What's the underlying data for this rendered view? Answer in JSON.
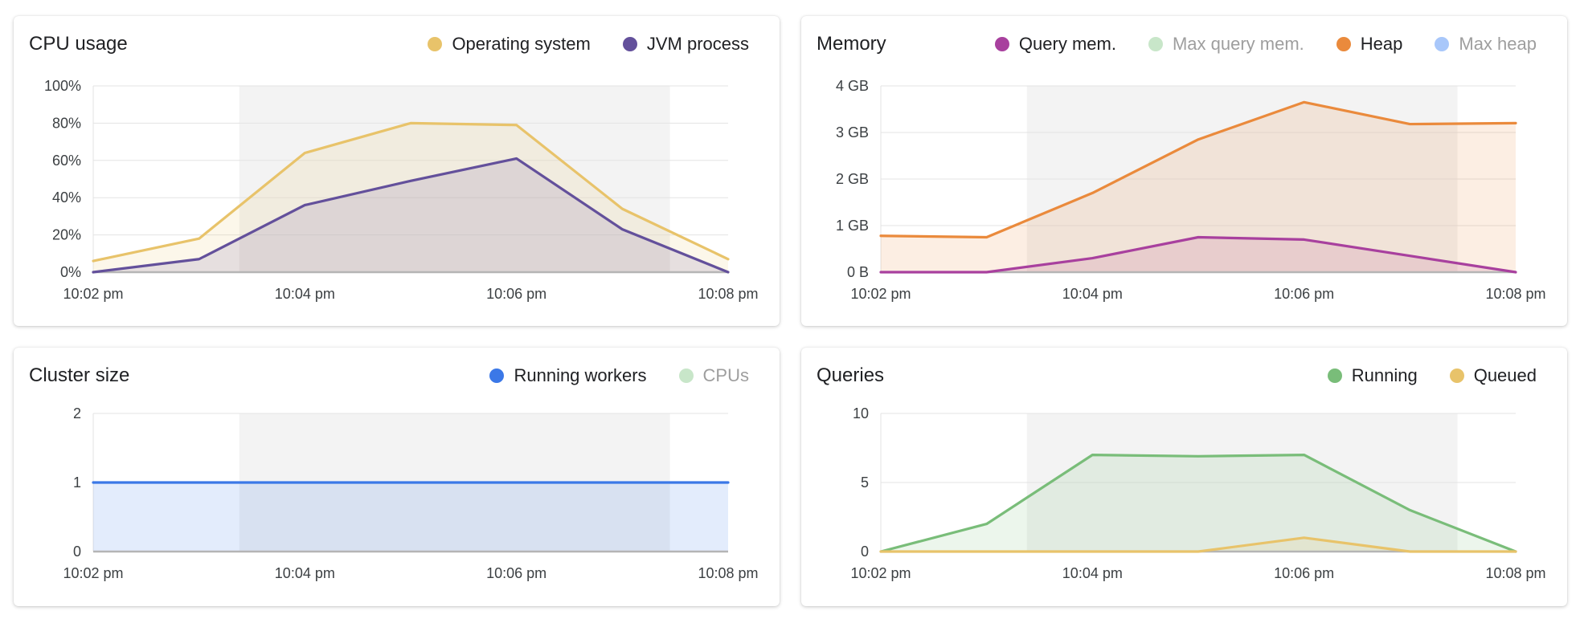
{
  "time_ticks": [
    "10:02 pm",
    "10:04 pm",
    "10:06 pm",
    "10:08 pm"
  ],
  "colors": {
    "os": "#e8c36a",
    "jvm": "#63509b",
    "query_mem": "#a8409e",
    "max_query_mem": "#c8e6c9",
    "heap": "#ea8a3c",
    "max_heap": "#a8c7fa",
    "running_workers": "#3b78e7",
    "cpus": "#c8e6c9",
    "running": "#79bd79",
    "queued": "#e8c36a",
    "highlight": "#f3f3f3",
    "grid": "#e3e3e3"
  },
  "panels": {
    "cpu": {
      "title": "CPU usage",
      "legend": [
        {
          "label": "Operating system",
          "color": "#e8c36a",
          "muted": false
        },
        {
          "label": "JVM process",
          "color": "#63509b",
          "muted": false
        }
      ]
    },
    "memory": {
      "title": "Memory",
      "legend": [
        {
          "label": "Query mem.",
          "color": "#a8409e",
          "muted": false
        },
        {
          "label": "Max query mem.",
          "color": "#c8e6c9",
          "muted": true
        },
        {
          "label": "Heap",
          "color": "#ea8a3c",
          "muted": false
        },
        {
          "label": "Max heap",
          "color": "#a8c7fa",
          "muted": true
        }
      ]
    },
    "cluster": {
      "title": "Cluster size",
      "legend": [
        {
          "label": "Running workers",
          "color": "#3b78e7",
          "muted": false
        },
        {
          "label": "CPUs",
          "color": "#c8e6c9",
          "muted": true
        }
      ]
    },
    "queries": {
      "title": "Queries",
      "legend": [
        {
          "label": "Running",
          "color": "#79bd79",
          "muted": false
        },
        {
          "label": "Queued",
          "color": "#e8c36a",
          "muted": false
        }
      ]
    }
  },
  "chart_data": [
    {
      "id": "cpu",
      "type": "area",
      "title": "CPU usage",
      "x_ticks": [
        "10:02 pm",
        "10:04 pm",
        "10:06 pm",
        "10:08 pm"
      ],
      "x_range": [
        0,
        6
      ],
      "highlight_range": [
        1.38,
        5.45
      ],
      "y_ticks": [
        "0%",
        "20%",
        "40%",
        "60%",
        "80%",
        "100%"
      ],
      "ylim": [
        0,
        100
      ],
      "grid": true,
      "legend": "top-right",
      "series": [
        {
          "name": "Operating system",
          "color": "#e8c36a",
          "x": [
            0,
            1,
            2,
            3,
            4,
            5,
            6
          ],
          "y": [
            6,
            18,
            64,
            80,
            79,
            34,
            7
          ]
        },
        {
          "name": "JVM process",
          "color": "#63509b",
          "x": [
            0,
            1,
            2,
            3,
            4,
            5,
            6
          ],
          "y": [
            0,
            7,
            36,
            49,
            61,
            23,
            0
          ]
        }
      ]
    },
    {
      "id": "memory",
      "type": "area",
      "title": "Memory",
      "x_ticks": [
        "10:02 pm",
        "10:04 pm",
        "10:06 pm",
        "10:08 pm"
      ],
      "x_range": [
        0,
        6
      ],
      "highlight_range": [
        1.38,
        5.45
      ],
      "y_ticks": [
        "0 B",
        "1 GB",
        "2 GB",
        "3 GB",
        "4 GB"
      ],
      "ylim": [
        0,
        4
      ],
      "grid": true,
      "legend": "top-right",
      "series": [
        {
          "name": "Query mem.",
          "color": "#a8409e",
          "x": [
            0,
            1,
            2,
            3,
            4,
            5,
            6
          ],
          "y": [
            0,
            0,
            0.3,
            0.75,
            0.7,
            0.35,
            0
          ]
        },
        {
          "name": "Heap",
          "color": "#ea8a3c",
          "x": [
            0,
            1,
            2,
            3,
            4,
            5,
            6
          ],
          "y": [
            0.78,
            0.75,
            1.7,
            2.85,
            3.65,
            3.18,
            3.2
          ]
        }
      ]
    },
    {
      "id": "cluster",
      "type": "area",
      "title": "Cluster size",
      "x_ticks": [
        "10:02 pm",
        "10:04 pm",
        "10:06 pm",
        "10:08 pm"
      ],
      "x_range": [
        0,
        6
      ],
      "highlight_range": [
        1.38,
        5.45
      ],
      "y_ticks": [
        "0",
        "1",
        "2"
      ],
      "ylim": [
        0,
        2
      ],
      "grid": true,
      "legend": "top-right",
      "series": [
        {
          "name": "Running workers",
          "color": "#3b78e7",
          "x": [
            0,
            6
          ],
          "y": [
            1,
            1
          ]
        }
      ]
    },
    {
      "id": "queries",
      "type": "area",
      "title": "Queries",
      "x_ticks": [
        "10:02 pm",
        "10:04 pm",
        "10:06 pm",
        "10:08 pm"
      ],
      "x_range": [
        0,
        6
      ],
      "highlight_range": [
        1.38,
        5.45
      ],
      "y_ticks": [
        "0",
        "5",
        "10"
      ],
      "ylim": [
        0,
        10
      ],
      "grid": true,
      "legend": "top-right",
      "series": [
        {
          "name": "Running",
          "color": "#79bd79",
          "x": [
            0,
            1,
            2,
            3,
            4,
            5,
            6
          ],
          "y": [
            0,
            2,
            7,
            6.9,
            7,
            3,
            0
          ]
        },
        {
          "name": "Queued",
          "color": "#e8c36a",
          "x": [
            0,
            1,
            2,
            3,
            4,
            5,
            6
          ],
          "y": [
            0,
            0,
            0,
            0,
            1,
            0,
            0
          ]
        }
      ]
    }
  ]
}
